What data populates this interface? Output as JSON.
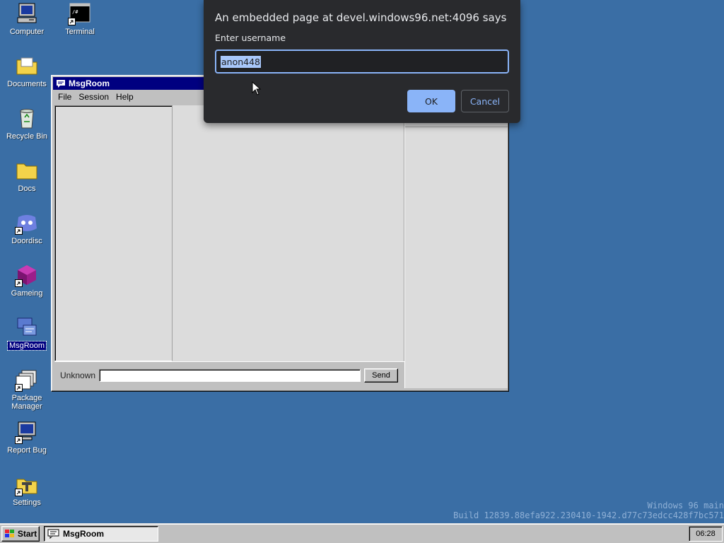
{
  "desktop": {
    "icons": [
      {
        "label": "Computer",
        "icon": "computer-icon"
      },
      {
        "label": "Terminal",
        "icon": "terminal-icon"
      },
      {
        "label": "Documents",
        "icon": "folder-icon"
      },
      {
        "label": "Recycle Bin",
        "icon": "recycle-bin-icon"
      },
      {
        "label": "Docs",
        "icon": "folder-icon"
      },
      {
        "label": "Doordisc",
        "icon": "doordisc-icon"
      },
      {
        "label": "Gameing",
        "icon": "cube-icon"
      },
      {
        "label": "MsgRoom",
        "icon": "msgroom-icon"
      },
      {
        "label": "Package Manager",
        "icon": "package-icon"
      },
      {
        "label": "Report Bug",
        "icon": "monitor-bug-icon"
      },
      {
        "label": "Settings",
        "icon": "settings-icon"
      }
    ],
    "watermark": {
      "line1": "Windows 96 main",
      "line2": "Build 12839.88efa922.230410-1942.d77c73edcc428f7bc571"
    }
  },
  "window": {
    "title": "MsgRoom",
    "menu": [
      "File",
      "Session",
      "Help"
    ],
    "nickname": "Unknown",
    "message_value": "",
    "send_label": "Send"
  },
  "prompt": {
    "title": "An embedded page at devel.windows96.net:4096 says",
    "message": "Enter username",
    "value": "anon448",
    "ok_label": "OK",
    "cancel_label": "Cancel",
    "accent": "#8ab4f8"
  },
  "taskbar": {
    "start_label": "Start",
    "task_label": "MsgRoom",
    "clock": "06:28"
  },
  "colors": {
    "desktop": "#3a6ea5",
    "title_bar": "#000080",
    "surface": "#c0c0c0"
  }
}
